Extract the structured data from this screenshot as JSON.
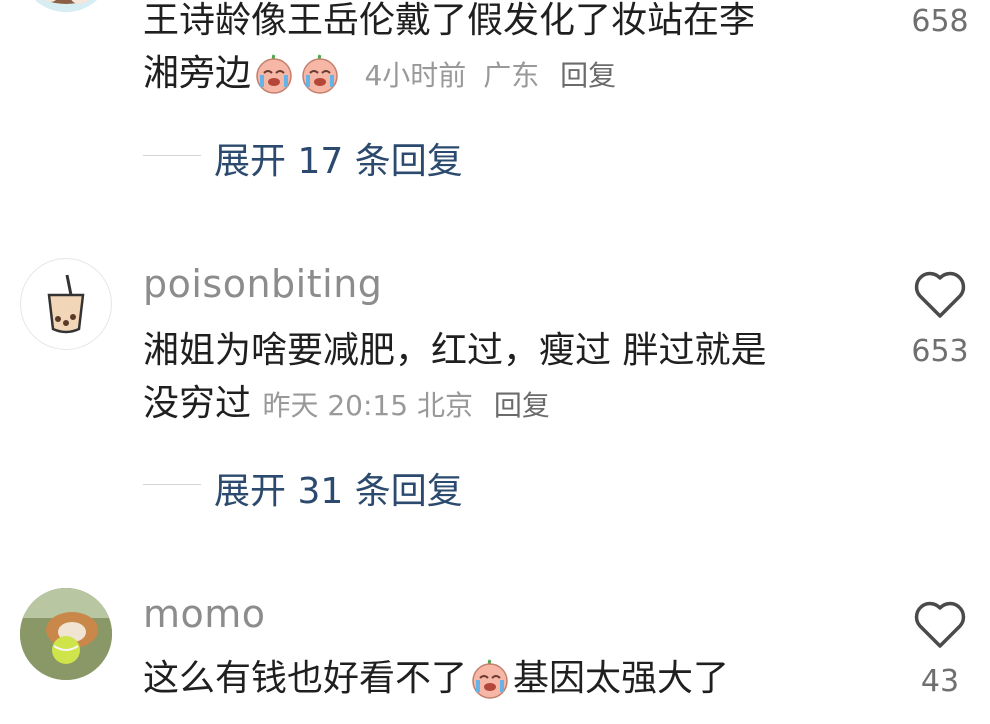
{
  "comments": [
    {
      "username": "",
      "text_line1": "王诗龄像王岳伦戴了假发化了妆站在李",
      "text_line2": "湘旁边",
      "time": "4小时前",
      "location": "广东",
      "reply_label": "回复",
      "likes": "658",
      "expand_label": "展开 17 条回复"
    },
    {
      "username": "poisonbiting",
      "text_line1": "湘姐为啥要减肥，红过，瘦过 胖过就是",
      "text_line2": "没穷过",
      "time": "昨天 20:15",
      "location": "北京",
      "reply_label": "回复",
      "likes": "653",
      "expand_label": "展开 31 条回复"
    },
    {
      "username": "momo",
      "text_part1": "这么有钱也好看不了",
      "text_part2": "基因太强大了",
      "likes": "43"
    }
  ],
  "colors": {
    "link_blue": "#2b4a6e",
    "text_dark": "#1f1f1f",
    "text_gray": "#8c8c8c"
  },
  "icons": [
    "heart-outline-icon",
    "crying-emoji-icon",
    "avatar-image"
  ]
}
